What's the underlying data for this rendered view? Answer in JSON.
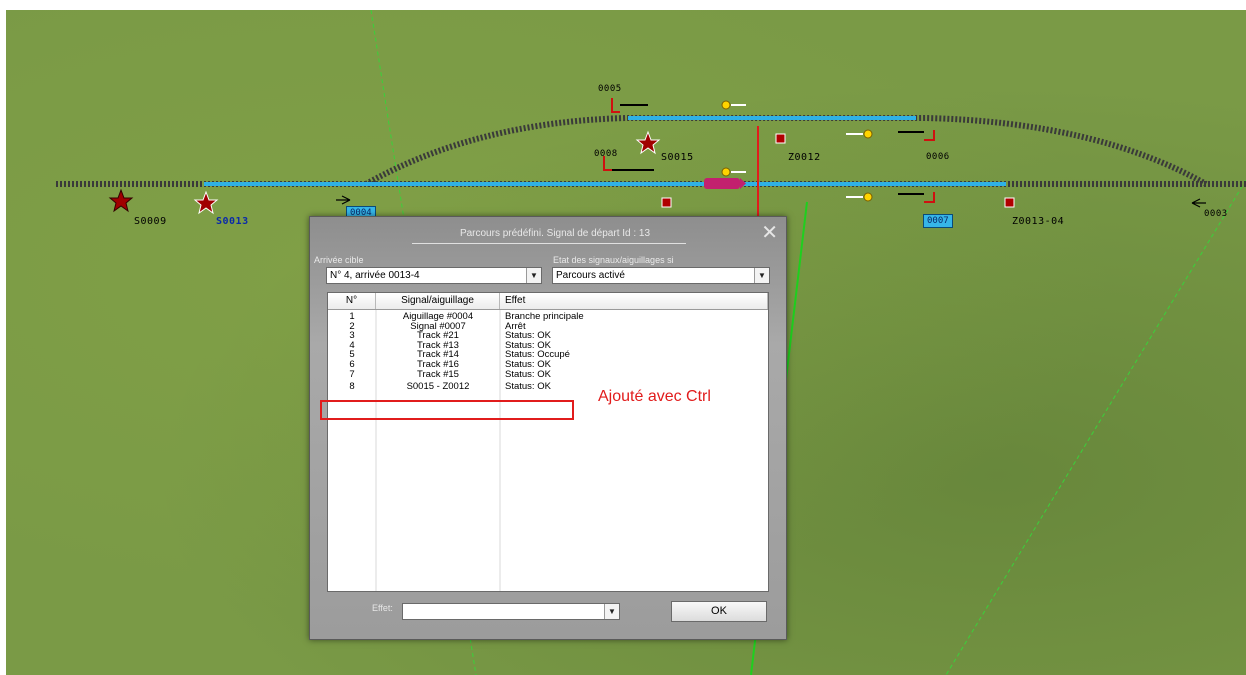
{
  "map": {
    "labels": {
      "s0009": "S0009",
      "s0013": "S0013",
      "s0015": "S0015",
      "z0012": "Z0012",
      "z0013_04": "Z0013-04",
      "d0005": "0005",
      "d0006": "0006",
      "d0008": "0008",
      "d0003": "0003",
      "tag_0004": "0004",
      "tag_0007": "0007"
    }
  },
  "dialog": {
    "title": "Parcours prédéfini. Signal de départ Id : 13",
    "close_label": "✕",
    "arrival_label": "Arrivée cible",
    "arrival_value": "N° 4, arrivée 0013-4",
    "state_label": "Etat des signaux/aiguillages si",
    "state_value": "Parcours activé",
    "columns": [
      "N°",
      "Signal/aiguillage",
      "Effet"
    ],
    "rows": [
      {
        "n": "1",
        "signal": "Aiguillage #0004",
        "effet": "Branche principale"
      },
      {
        "n": "2",
        "signal": "Signal #0007",
        "effet": "Arrêt"
      },
      {
        "n": "3",
        "signal": "Track #21",
        "effet": "Status: OK"
      },
      {
        "n": "4",
        "signal": "Track #13",
        "effet": "Status: OK"
      },
      {
        "n": "5",
        "signal": "Track #14",
        "effet": "Status: Occupé"
      },
      {
        "n": "6",
        "signal": "Track #16",
        "effet": "Status: OK"
      },
      {
        "n": "7",
        "signal": "Track #15",
        "effet": "Status: OK"
      },
      {
        "n": "8",
        "signal": "S0015 - Z0012",
        "effet": "Status: OK"
      }
    ],
    "effet_label": "Effet:",
    "effet_value": "",
    "ok_label": "OK"
  },
  "annotation": {
    "text": "Ajouté avec Ctrl",
    "color": "#e11c1c"
  },
  "colors": {
    "route_blue": "#2fb1e6",
    "signal_red": "#d01010",
    "grass": "#7a9a46",
    "train_magenta": "#c2206e"
  }
}
